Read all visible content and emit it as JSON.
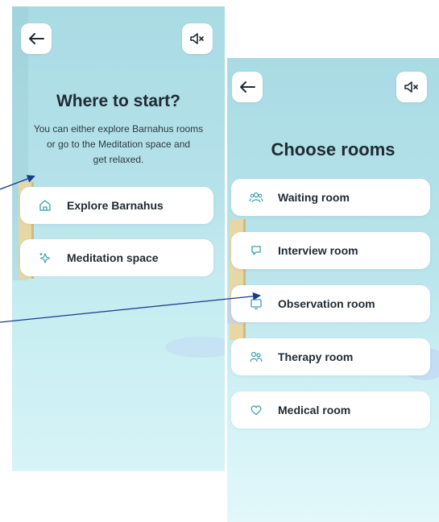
{
  "colors": {
    "accent": "#3aa3a8",
    "arrow": "#1a3a8a",
    "text": "#1f2a33"
  },
  "screen1": {
    "back_icon": "arrow-left-icon",
    "sound_icon": "speaker-muted-icon",
    "title": "Where to start?",
    "subtitle_lines": [
      "You can either explore Barnahus rooms",
      "or go to the Meditation space and",
      "get relaxed."
    ],
    "options": [
      {
        "label": "Explore Barnahus",
        "icon": "home-icon"
      },
      {
        "label": "Meditation space",
        "icon": "sparkle-icon"
      }
    ]
  },
  "screen2": {
    "back_icon": "arrow-left-icon",
    "sound_icon": "speaker-muted-icon",
    "title": "Choose rooms",
    "rooms": [
      {
        "label": "Waiting room",
        "icon": "users-icon"
      },
      {
        "label": "Interview room",
        "icon": "chat-icon"
      },
      {
        "label": "Observation room",
        "icon": "monitor-icon"
      },
      {
        "label": "Therapy room",
        "icon": "people-icon"
      },
      {
        "label": "Medical room",
        "icon": "heart-icon"
      }
    ]
  }
}
